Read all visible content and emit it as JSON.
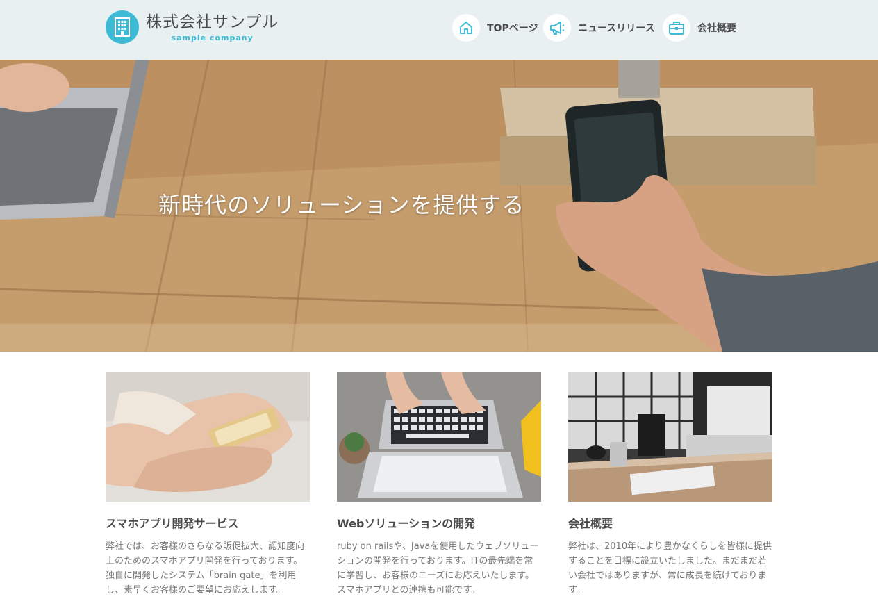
{
  "header": {
    "logo_title": "株式会社サンプル",
    "logo_subtitle": "sample company",
    "nav": [
      {
        "label": "TOPページ",
        "icon": "home-icon"
      },
      {
        "label": "ニュースリリース",
        "icon": "megaphone-icon"
      },
      {
        "label": "会社概要",
        "icon": "briefcase-icon"
      }
    ]
  },
  "hero": {
    "title": "新時代のソリューションを提供する"
  },
  "cards": [
    {
      "title": "スマホアプリ開発サービス",
      "body": "弊社では、お客様のさらなる販促拡大、認知度向上のためのスマホアプリ開発を行っております。独自に開発したシステム「brain gate」を利用し、素早くお客様のご要望にお応えします。"
    },
    {
      "title": "Webソリューションの開発",
      "body": "ruby on railsや、Javaを使用したウェブソリューションの開発を行っております。ITの最先端を常に学習し、お客様のニーズにお応えいたします。スマホアプリとの連携も可能です。"
    },
    {
      "title": "会社概要",
      "body": "弊社は、2010年により豊かなくらしを皆様に提供することを目標に設立いたしました。まだまだ若い会社ではありますが、常に成長を続けております。"
    }
  ],
  "colors": {
    "accent": "#3dbbd6",
    "header_bg": "#e8f0f2"
  }
}
